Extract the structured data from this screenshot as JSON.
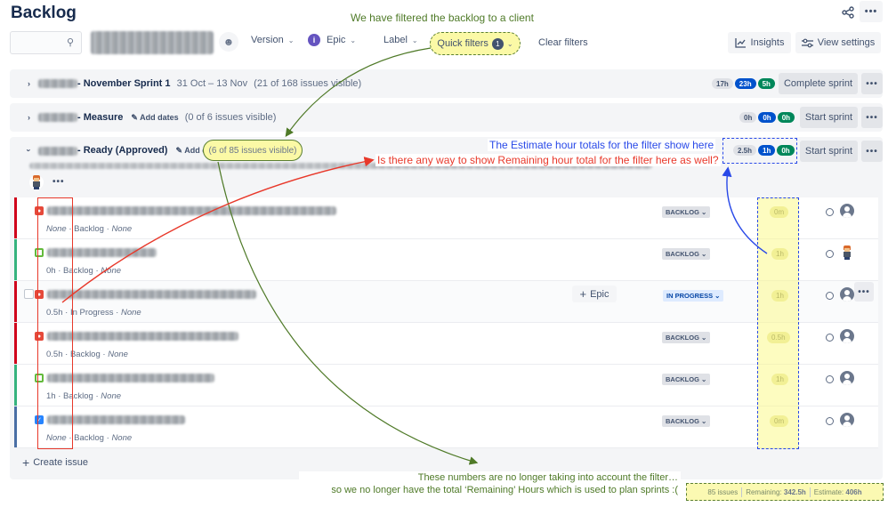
{
  "header": {
    "title": "Backlog",
    "share_icon": "share-icon",
    "more_icon": "more-icon"
  },
  "toolbar": {
    "search_placeholder": "",
    "search_icon": "search-icon",
    "add_people_icon": "add-people-icon",
    "version_label": "Version",
    "epic_label": "Epic",
    "label_label": "Label",
    "quick_filters_label": "Quick filters",
    "quick_filters_count": "1",
    "clear_filters_label": "Clear filters",
    "insights_label": "Insights",
    "view_settings_label": "View settings"
  },
  "sprints": [
    {
      "name": "- November Sprint 1",
      "dates": "31 Oct – 13 Nov",
      "visible": "(21 of 168 issues visible)",
      "expanded": false,
      "pills": [
        "17h",
        "23h",
        "5h"
      ],
      "action": "Complete sprint"
    },
    {
      "name": "- Measure",
      "add_dates": "Add dates",
      "visible": "(0 of 6 issues visible)",
      "expanded": false,
      "pills": [
        "0h",
        "0h",
        "0h"
      ],
      "action": "Start sprint"
    },
    {
      "name": "- Ready (Approved)",
      "add_dates": "Add dates",
      "visible": "(6 of 85 issues visible)",
      "expanded": true,
      "pills": [
        "2.5h",
        "1h",
        "0h"
      ],
      "action": "Start sprint",
      "create_issue": "Create issue",
      "issues": [
        {
          "type": "bug",
          "estimate": "None",
          "status_text": "Backlog",
          "epic": "None",
          "status": "BACKLOG",
          "time": "0m",
          "assignee": "unassigned",
          "bar_color": "#d0021b"
        },
        {
          "type": "story",
          "estimate": "0h",
          "status_text": "Backlog",
          "epic": "None",
          "status": "BACKLOG",
          "time": "1h",
          "assignee": "pixel-avatar",
          "bar_color": "#36b37e"
        },
        {
          "type": "bug",
          "estimate": "0.5h",
          "status_text": "In Progress",
          "epic": "None",
          "status": "IN PROGRESS",
          "time": "1h",
          "assignee": "unassigned",
          "bar_color": "#d0021b",
          "add_epic": "Epic"
        },
        {
          "type": "bug",
          "estimate": "0.5h",
          "status_text": "Backlog",
          "epic": "None",
          "status": "BACKLOG",
          "time": "0.5h",
          "assignee": "unassigned",
          "bar_color": "#d0021b"
        },
        {
          "type": "story",
          "estimate": "1h",
          "status_text": "Backlog",
          "epic": "None",
          "status": "BACKLOG",
          "time": "1h",
          "assignee": "unassigned",
          "bar_color": "#36b37e"
        },
        {
          "type": "task",
          "estimate": "None",
          "status_text": "Backlog",
          "epic": "None",
          "status": "BACKLOG",
          "time": "0m",
          "assignee": "unassigned",
          "bar_color": "#4a6fa5"
        }
      ]
    }
  ],
  "footer": {
    "issues": "85 issues",
    "remaining_label": "Remaining:",
    "remaining_value": "342.5h",
    "estimate_label": "Estimate:",
    "estimate_value": "406h"
  },
  "annotations": {
    "top_note": "We have filtered the backlog to a client",
    "estimate_note": "The Estimate hour totals for the filter show here",
    "remaining_question": "Is there any way to show Remaining hour total for the filter here as well?",
    "footer_note_line1": "These numbers are no longer taking into account the filter…",
    "footer_note_line2": "so we no longer have the total ‘Remaining’ Hours which is used to plan sprints :(",
    "colors": {
      "green": "#4f7a28",
      "blue": "#2949e8",
      "red": "#e8382a",
      "highlight": "#fbf9a6"
    }
  }
}
